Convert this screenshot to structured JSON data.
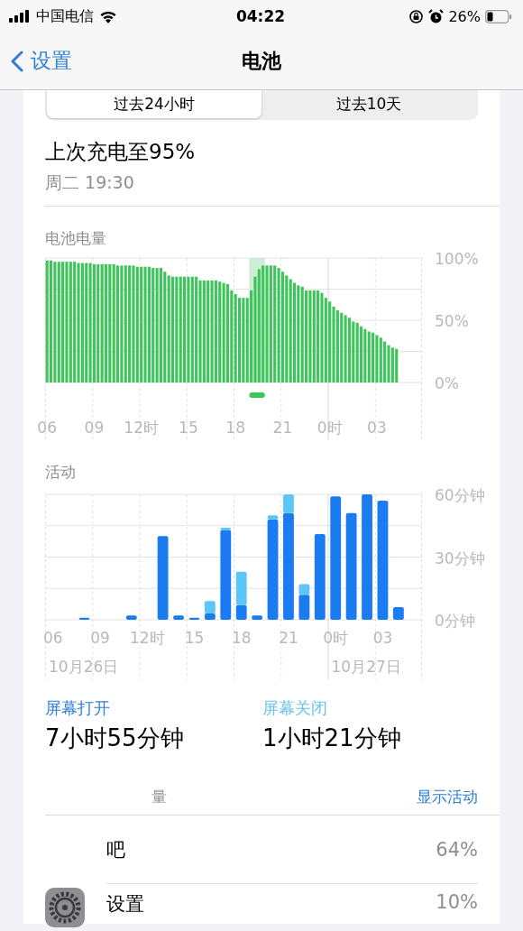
{
  "status_bar": {
    "carrier": "中国电信",
    "time": "04:22",
    "battery_percent": "26%"
  },
  "nav": {
    "back": "设置",
    "title": "电池"
  },
  "tabs": [
    {
      "label": "过去24小时",
      "selected": true
    },
    {
      "label": "过去10天",
      "selected": false
    }
  ],
  "last_charge": {
    "title": "上次充电至95%",
    "time": "周二 19:30"
  },
  "battery_level": {
    "chart_data": {
      "type": "bar",
      "ylim": [
        0,
        100
      ],
      "yticks": [
        {
          "value": 0,
          "label": "0%"
        },
        {
          "value": 50,
          "label": "50%"
        },
        {
          "value": 100,
          "label": "100%"
        }
      ],
      "categories": [
        "06",
        null,
        null,
        null,
        null,
        null,
        null,
        null,
        null,
        null,
        null,
        null,
        "09",
        null,
        null,
        null,
        null,
        null,
        null,
        null,
        null,
        null,
        null,
        null,
        "12时",
        null,
        null,
        null,
        null,
        null,
        null,
        null,
        null,
        null,
        null,
        null,
        "15",
        null,
        null,
        null,
        null,
        null,
        null,
        null,
        null,
        null,
        null,
        null,
        "18",
        null,
        null,
        null,
        null,
        null,
        null,
        null,
        null,
        null,
        null,
        null,
        "21",
        null,
        null,
        null,
        null,
        null,
        null,
        null,
        null,
        null,
        null,
        null,
        "0时",
        null,
        null,
        null,
        null,
        null,
        null,
        null,
        null,
        null,
        null,
        null,
        "03",
        null,
        null,
        null,
        null,
        null
      ],
      "series": [
        {
          "name": "电池电量",
          "color": "#3fc45c",
          "values": [
            98,
            98,
            97,
            97,
            97,
            97,
            97,
            97,
            96,
            96,
            96,
            96,
            95,
            95,
            95,
            95,
            95,
            95,
            94,
            94,
            94,
            94,
            94,
            93,
            93,
            93,
            93,
            92,
            92,
            92,
            89,
            86,
            85,
            85,
            85,
            85,
            85,
            85,
            85,
            82,
            82,
            82,
            82,
            82,
            81,
            80,
            79,
            74,
            71,
            68,
            68,
            68,
            74,
            85,
            91,
            94,
            94,
            94,
            94,
            92,
            89,
            86,
            83,
            80,
            78,
            77,
            74,
            74,
            74,
            74,
            72,
            68,
            65,
            61,
            58,
            56,
            54,
            52,
            49,
            48,
            45,
            43,
            41,
            40,
            38,
            36,
            33,
            30,
            28,
            27
          ]
        }
      ],
      "grid": true
    }
  },
  "activity": {
    "chart_data": {
      "type": "bar",
      "title": "活动",
      "stacked": true,
      "grid": true,
      "ylim": [
        0,
        60
      ],
      "yticks": [
        {
          "value": 0,
          "label": "0分钟"
        },
        {
          "value": 30,
          "label": "30分钟"
        },
        {
          "value": 60,
          "label": "60分钟"
        }
      ],
      "categories": [
        "06",
        null,
        null,
        "09",
        null,
        null,
        "12时",
        null,
        null,
        "15",
        null,
        null,
        "18",
        null,
        null,
        "21",
        null,
        null,
        "0时",
        null,
        null,
        "03",
        null,
        null
      ],
      "series": [
        {
          "name": "屏幕打开",
          "color": "#1a7cf0",
          "values": [
            null,
            null,
            1,
            null,
            null,
            2,
            null,
            40,
            2,
            1,
            3,
            43,
            7,
            2,
            48,
            51,
            12,
            41,
            59,
            51,
            60,
            57,
            6,
            null
          ]
        },
        {
          "name": "屏幕关闭",
          "color": "#5cc6f7",
          "values": [
            null,
            null,
            null,
            null,
            null,
            null,
            null,
            null,
            null,
            null,
            6,
            1,
            16,
            null,
            2,
            9,
            5,
            null,
            null,
            null,
            null,
            null,
            null,
            null
          ]
        }
      ]
    },
    "date_labels": [
      "10月26日",
      "10月27日"
    ]
  },
  "screen_time": [
    {
      "value": "7小时55分钟",
      "color": "#2f7fd6"
    },
    {
      "value": "1小时21分钟",
      "color": "#6cc3e8"
    }
  ],
  "usage": {
    "header": "量",
    "action": "显示活动",
    "apps": [
      {
        "name": "吧",
        "percent": "64%",
        "kind": "covered"
      },
      {
        "name": "设置",
        "percent": "10%",
        "kind": "settings"
      }
    ]
  }
}
